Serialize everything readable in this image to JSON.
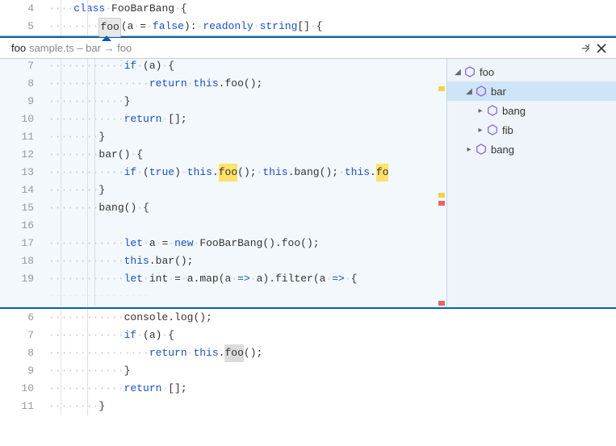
{
  "top": {
    "lines": [
      {
        "num": "4"
      },
      {
        "num": "5"
      }
    ],
    "kw_class": "class",
    "class_name": "FooBarBang",
    "method_name": "foo",
    "param": "a",
    "eq": "=",
    "false_kw": "false",
    "readonly": "readonly",
    "string": "string"
  },
  "peek": {
    "title_strong": "foo",
    "title_file": "sample.ts",
    "title_path": " – bar → foo",
    "lines_nums": [
      "",
      "7",
      "8",
      "9",
      "10",
      "11",
      "12",
      "13",
      "14",
      "15",
      "16",
      "17",
      "18",
      "19",
      ""
    ],
    "tokens": {
      "console_log": "console.log();",
      "if": "if",
      "a": "a",
      "return": "return",
      "this": "this",
      "foo": "foo",
      "empty_arr": "[]",
      "bar": "bar",
      "true": "true",
      "bang": "bang",
      "let": "let",
      "avar": "a",
      "new": "new",
      "FooBarBang": "FooBarBang",
      "int": "int",
      "map": "map",
      "filter": "filter",
      "arrow": "=>"
    }
  },
  "tree": {
    "items": [
      {
        "label": "foo",
        "depth": 0,
        "expanded": true,
        "selected": false
      },
      {
        "label": "bar",
        "depth": 1,
        "expanded": true,
        "selected": true
      },
      {
        "label": "bang",
        "depth": 2,
        "expanded": false,
        "selected": false
      },
      {
        "label": "fib",
        "depth": 2,
        "expanded": false,
        "selected": false
      },
      {
        "label": "bang",
        "depth": 1,
        "expanded": false,
        "selected": false
      }
    ]
  },
  "bottom": {
    "nums": [
      "6",
      "7",
      "8",
      "9",
      "10",
      "11"
    ]
  }
}
